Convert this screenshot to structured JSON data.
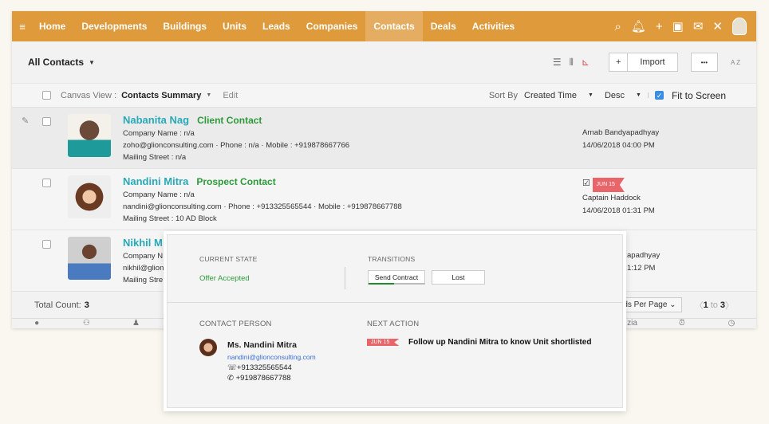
{
  "nav": {
    "tabs": [
      "Home",
      "Developments",
      "Buildings",
      "Units",
      "Leads",
      "Companies",
      "Contacts",
      "Deals",
      "Activities"
    ],
    "active": "Contacts"
  },
  "toolbar": {
    "title": "All Contacts",
    "import_label": "Import",
    "more_label": "•••",
    "sort_icon_label": "A Z"
  },
  "canvas_bar": {
    "canvas_view_label": "Canvas View :",
    "canvas_view_value": "Contacts Summary",
    "edit_label": "Edit",
    "sort_by_label": "Sort By",
    "sort_field": "Created Time",
    "sort_order": "Desc",
    "fit_to_screen_label": "Fit to Screen",
    "fit_to_screen_checked": true
  },
  "contacts": [
    {
      "name": "Nabanita Nag",
      "type": "Client Contact",
      "company": "Company Name : n/a",
      "email": "zoho@glionconsulting.com",
      "phone": "Phone : n/a",
      "mobile": "Mobile : +919878667766",
      "street": "Mailing Street : n/a",
      "owner": "Arnab Bandyapadhyay",
      "time": "14/06/2018 04:00 PM"
    },
    {
      "name": "Nandini Mitra",
      "type": "Prospect Contact",
      "company": "Company Name : n/a",
      "email": "nandini@glionconsulting.com",
      "phone": "Phone : +913325565544",
      "mobile": "Mobile : +919878667788",
      "street": "Mailing Street : 10 AD Block",
      "owner": "Captain Haddock",
      "time": "14/06/2018 01:31 PM",
      "flag": "JUN 15"
    },
    {
      "name": "Nikhil M",
      "type": "",
      "company": "Company N",
      "email": "nikhil@glion",
      "phone": "",
      "mobile": "",
      "street": "Mailing Stre",
      "owner": "apadhyay",
      "time": "1:12 PM"
    }
  ],
  "footer": {
    "total_label": "Total Count:",
    "total": "3",
    "per_page": "ds Per Page",
    "page_from": "1",
    "page_to_label": "to",
    "page_to": "3"
  },
  "popup": {
    "current_state_label": "CURRENT STATE",
    "current_state": "Offer Accepted",
    "transitions_label": "TRANSITIONS",
    "transitions": [
      "Send Contract",
      "Lost"
    ],
    "contact_person_label": "CONTACT PERSON",
    "person_name": "Ms. Nandini Mitra",
    "person_email": "nandini@glionconsulting.com",
    "person_phone": "+913325565544",
    "person_mobile": "+919878667788",
    "next_action_label": "NEXT ACTION",
    "next_action_flag": "JUN 15",
    "next_action": "Follow up Nandini Mitra to know Unit shortlisted"
  },
  "colors": {
    "nav": "#df9a3c",
    "accent_name": "#27a9b8",
    "status_green": "#2d9a3a",
    "flag": "#e8656a"
  }
}
